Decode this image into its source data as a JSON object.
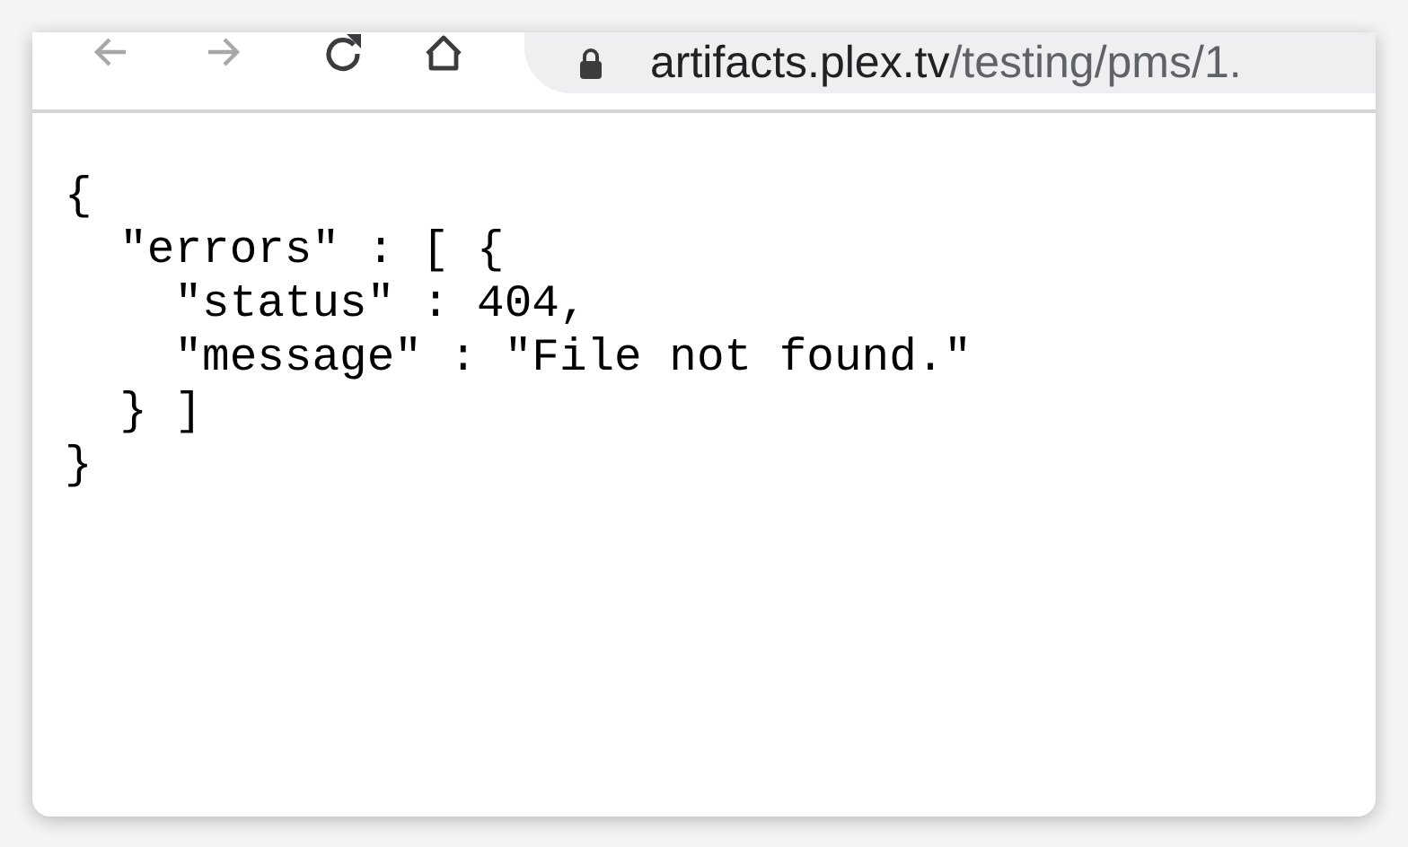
{
  "toolbar": {
    "buttons": [
      {
        "kind": "back",
        "disabled": true
      },
      {
        "kind": "forward",
        "disabled": true
      },
      {
        "kind": "reload",
        "disabled": false
      },
      {
        "kind": "home",
        "disabled": false
      }
    ],
    "address": {
      "host": "artifacts.plex.tv",
      "path": "/testing/pms/1."
    }
  },
  "body": {
    "lines": [
      "{",
      "  \"errors\" : [ {",
      "    \"status\" : 404,",
      "    \"message\" : \"File not found.\"",
      "  } ]",
      "}"
    ]
  }
}
